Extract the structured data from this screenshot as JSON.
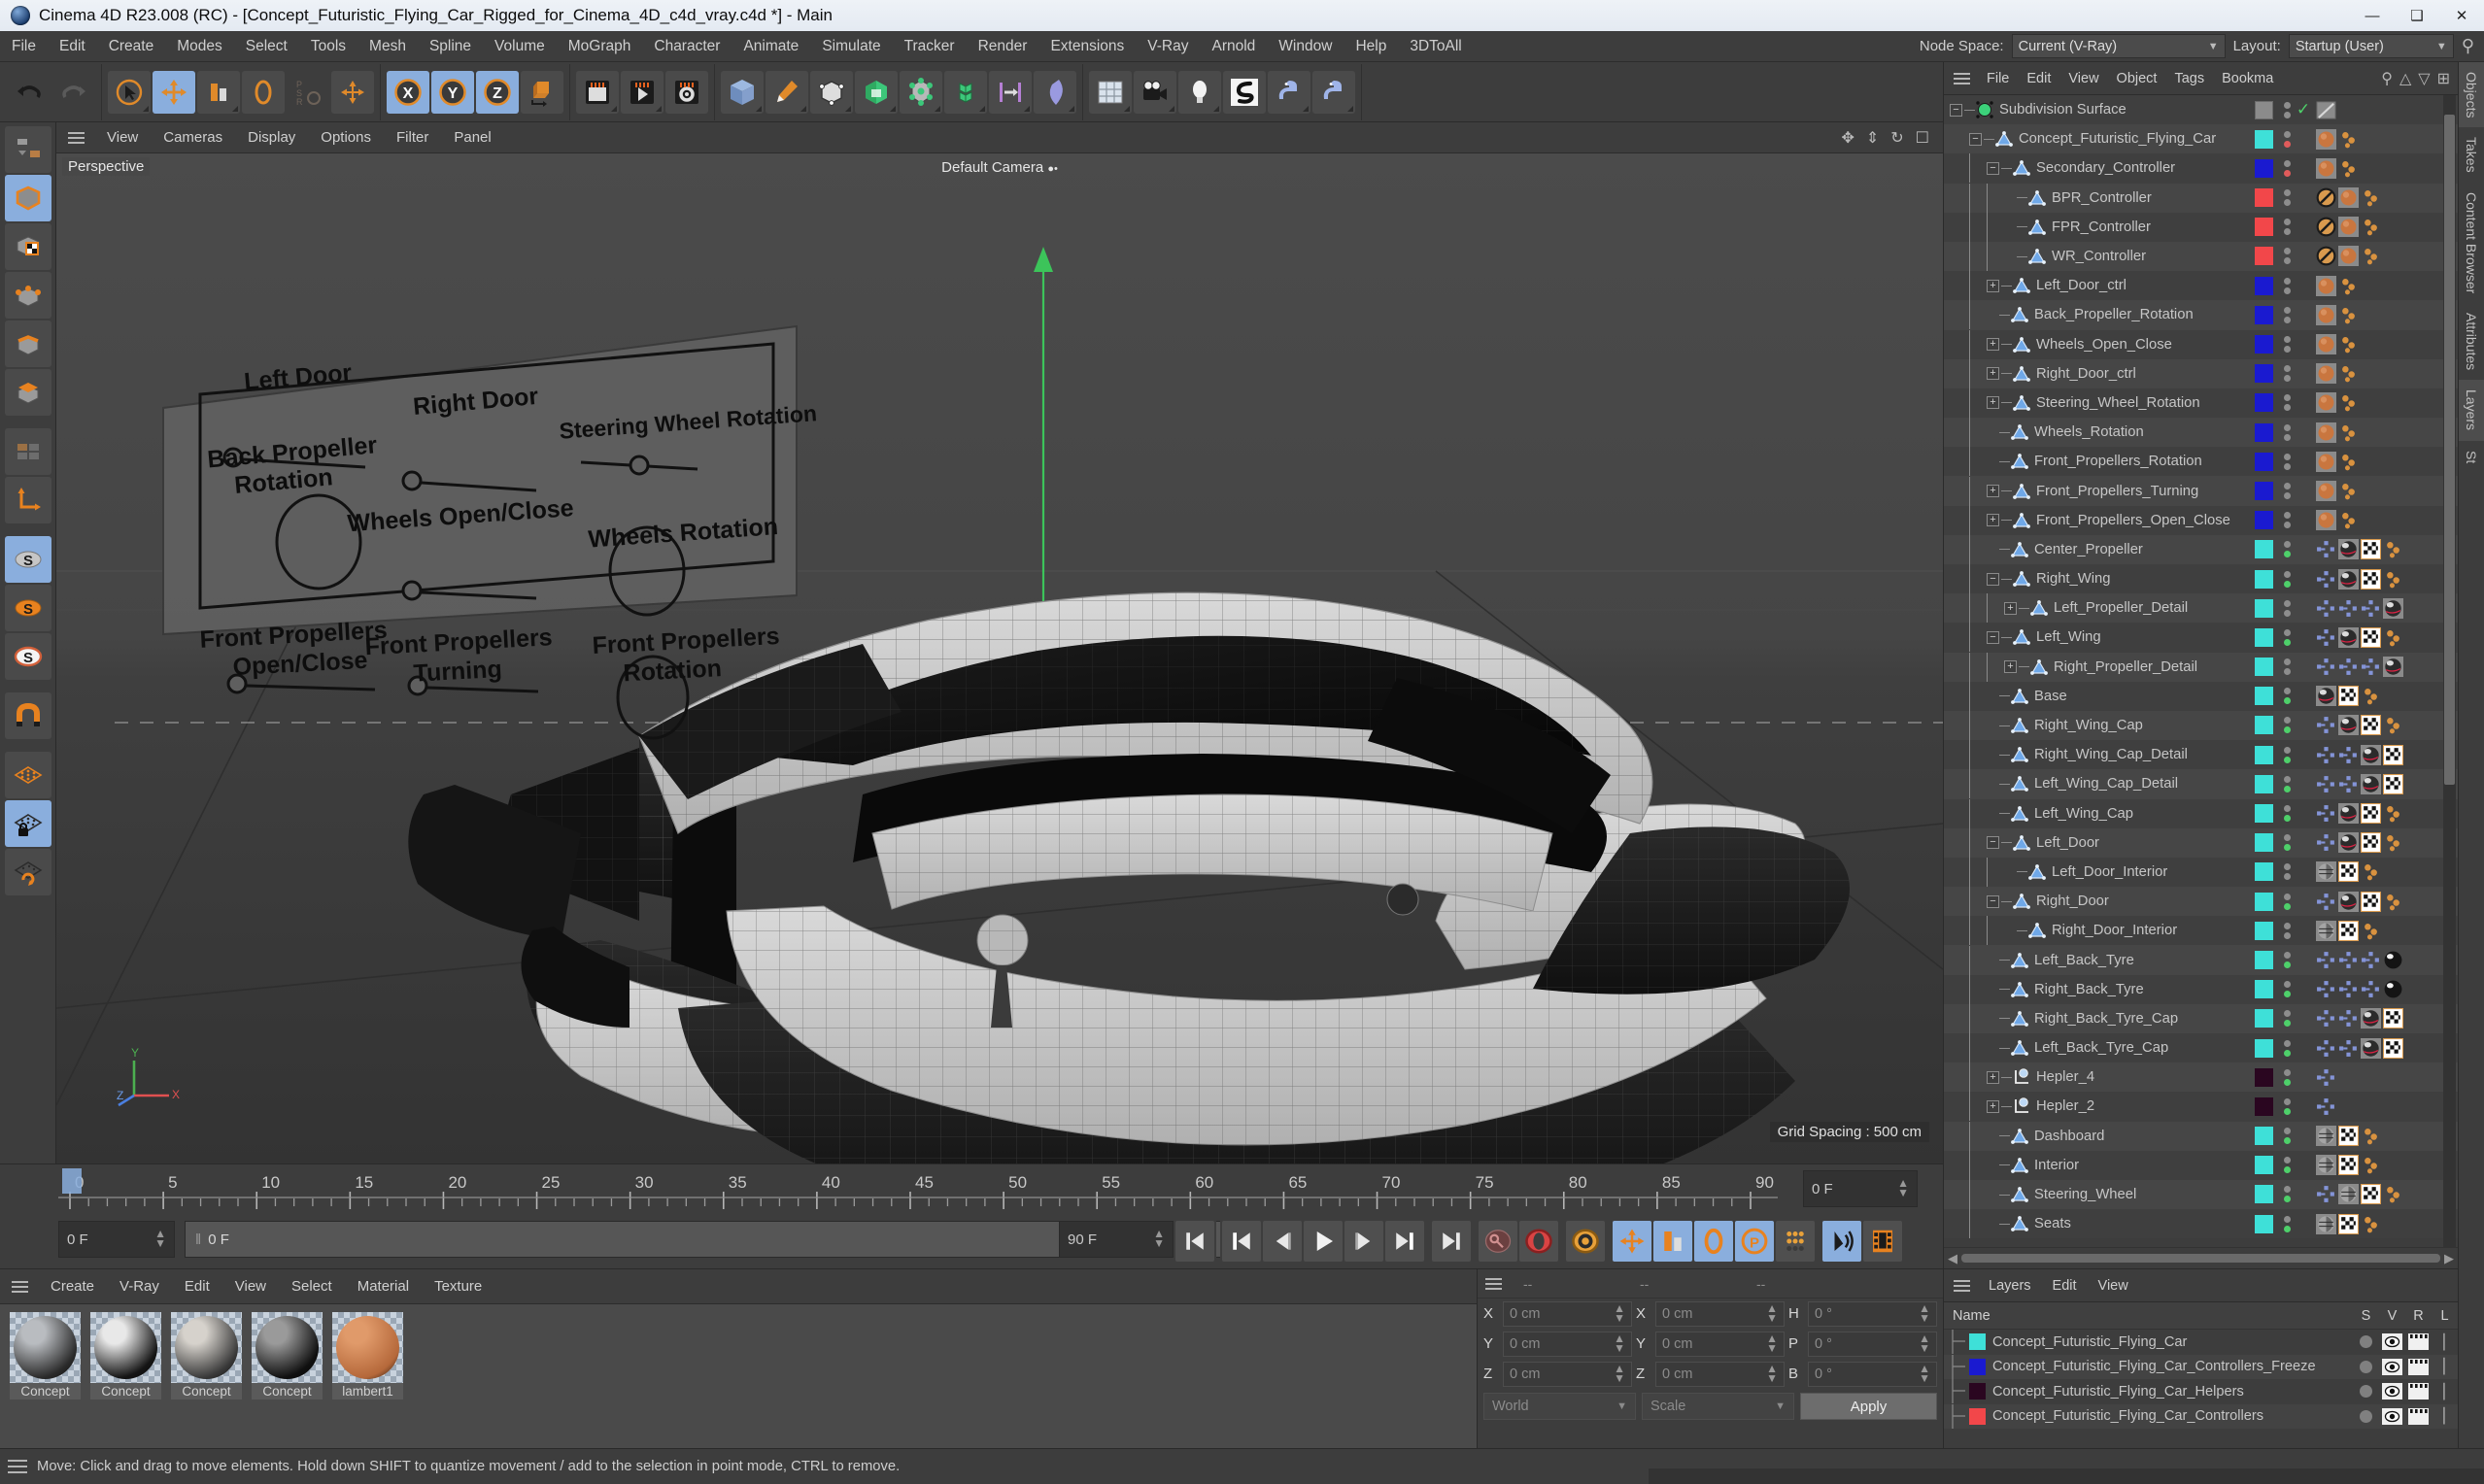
{
  "window": {
    "title": "Cinema 4D R23.008 (RC) - [Concept_Futuristic_Flying_Car_Rigged_for_Cinema_4D_c4d_vray.c4d *] - Main",
    "minimize": "—",
    "maximize": "❑",
    "close": "✕"
  },
  "menubar": {
    "items": [
      "File",
      "Edit",
      "Create",
      "Modes",
      "Select",
      "Tools",
      "Mesh",
      "Spline",
      "Volume",
      "MoGraph",
      "Character",
      "Animate",
      "Simulate",
      "Tracker",
      "Render",
      "Extensions",
      "V-Ray",
      "Arnold",
      "Window",
      "Help",
      "3DToAll"
    ],
    "node_space_label": "Node Space:",
    "node_space_value": "Current (V-Ray)",
    "layout_label": "Layout:",
    "layout_value": "Startup (User)"
  },
  "viewport": {
    "menu": [
      "View",
      "Cameras",
      "Display",
      "Options",
      "Filter",
      "Panel"
    ],
    "label": "Perspective",
    "camera": "Default Camera",
    "grid_spacing": "Grid Spacing : 500 cm",
    "axis": {
      "x": "X",
      "y": "Y",
      "z": "Z"
    },
    "hud_controls": [
      "Left Door",
      "Right Door",
      "Steering Wheel Rotation",
      "Back Propeller Rotation",
      "Wheels Open/Close",
      "Wheels Rotation",
      "Front Propellers Open/Close",
      "Front Propellers Turning",
      "Front Propellers Rotation"
    ]
  },
  "timeline": {
    "ticks": [
      0,
      5,
      10,
      15,
      20,
      25,
      30,
      35,
      40,
      45,
      50,
      55,
      60,
      65,
      70,
      75,
      80,
      85,
      90
    ],
    "current_frame": "0 F",
    "bar_frame": "0 F",
    "range_end": "90 F",
    "end_field": "90 F",
    "right_field": "0 F",
    "playhead_frame": 0
  },
  "materials": {
    "menu": [
      "Create",
      "V-Ray",
      "Edit",
      "View",
      "Select",
      "Material",
      "Texture"
    ],
    "items": [
      {
        "name": "Concept",
        "color1": "#b9bcc0",
        "color2": "#2b2b2b"
      },
      {
        "name": "Concept",
        "color1": "#e8e8e8",
        "color2": "#151515"
      },
      {
        "name": "Concept",
        "color1": "#d6d2cc",
        "color2": "#3a3a3a"
      },
      {
        "name": "Concept",
        "color1": "#9a9a9a",
        "color2": "#101010"
      },
      {
        "name": "lambert1",
        "color1": "#e09a6a",
        "color2": "#b5683a"
      }
    ]
  },
  "coordinates": {
    "header": [
      "--",
      "--",
      "--"
    ],
    "rows": [
      {
        "l1": "X",
        "v1": "0 cm",
        "l2": "X",
        "v2": "0 cm",
        "l3": "H",
        "v3": "0 °"
      },
      {
        "l1": "Y",
        "v1": "0 cm",
        "l2": "Y",
        "v2": "0 cm",
        "l3": "P",
        "v3": "0 °"
      },
      {
        "l1": "Z",
        "v1": "0 cm",
        "l2": "Z",
        "v2": "0 cm",
        "l3": "B",
        "v3": "0 °"
      }
    ],
    "world": "World",
    "scale": "Scale",
    "apply": "Apply"
  },
  "object_manager": {
    "menu": [
      "File",
      "Edit",
      "View",
      "Object",
      "Tags",
      "Bookma"
    ],
    "rows": [
      {
        "name": "Subdivision Surface",
        "depth": 0,
        "expander": "minus",
        "icon": "subdivision",
        "swatch": null,
        "dots": "check",
        "tags": [
          "disabled-slash"
        ]
      },
      {
        "name": "Concept_Futuristic_Flying_Car",
        "depth": 1,
        "expander": "minus",
        "icon": "null",
        "swatch": "#3ee0d8",
        "dots": "gray-red",
        "tags": [
          "ball-orange",
          "dots-orange"
        ]
      },
      {
        "name": "Secondary_Controller",
        "depth": 2,
        "expander": "minus",
        "icon": "null",
        "swatch": "#1a1ad0",
        "dots": "gray-red",
        "tags": [
          "ball-orange",
          "dots-orange"
        ]
      },
      {
        "name": "BPR_Controller",
        "depth": 3,
        "expander": "none",
        "icon": "null",
        "swatch": "#f2474a",
        "dots": "gray-gray",
        "tags": [
          "slash",
          "ball-orange",
          "dots-orange"
        ]
      },
      {
        "name": "FPR_Controller",
        "depth": 3,
        "expander": "none",
        "icon": "null",
        "swatch": "#f2474a",
        "dots": "gray-gray",
        "tags": [
          "slash",
          "ball-orange",
          "dots-orange"
        ]
      },
      {
        "name": "WR_Controller",
        "depth": 3,
        "expander": "none",
        "icon": "null",
        "swatch": "#f2474a",
        "dots": "gray-gray",
        "tags": [
          "slash",
          "ball-orange",
          "dots-orange"
        ]
      },
      {
        "name": "Left_Door_ctrl",
        "depth": 2,
        "expander": "plus",
        "icon": "null",
        "swatch": "#1a1ad0",
        "dots": "gray-gray",
        "tags": [
          "ball-orange",
          "dots-orange"
        ]
      },
      {
        "name": "Back_Propeller_Rotation",
        "depth": 2,
        "expander": "none",
        "icon": "null",
        "swatch": "#1a1ad0",
        "dots": "gray-gray",
        "tags": [
          "ball-orange",
          "dots-orange"
        ]
      },
      {
        "name": "Wheels_Open_Close",
        "depth": 2,
        "expander": "plus",
        "icon": "null",
        "swatch": "#1a1ad0",
        "dots": "gray-gray",
        "tags": [
          "ball-orange",
          "dots-orange"
        ]
      },
      {
        "name": "Right_Door_ctrl",
        "depth": 2,
        "expander": "plus",
        "icon": "null",
        "swatch": "#1a1ad0",
        "dots": "gray-gray",
        "tags": [
          "ball-orange",
          "dots-orange"
        ]
      },
      {
        "name": "Steering_Wheel_Rotation",
        "depth": 2,
        "expander": "plus",
        "icon": "null",
        "swatch": "#1a1ad0",
        "dots": "gray-gray",
        "tags": [
          "ball-orange",
          "dots-orange"
        ]
      },
      {
        "name": "Wheels_Rotation",
        "depth": 2,
        "expander": "none",
        "icon": "null",
        "swatch": "#1a1ad0",
        "dots": "gray-gray",
        "tags": [
          "ball-orange",
          "dots-orange"
        ]
      },
      {
        "name": "Front_Propellers_Rotation",
        "depth": 2,
        "expander": "none",
        "icon": "null",
        "swatch": "#1a1ad0",
        "dots": "gray-gray",
        "tags": [
          "ball-orange",
          "dots-orange"
        ]
      },
      {
        "name": "Front_Propellers_Turning",
        "depth": 2,
        "expander": "plus",
        "icon": "null",
        "swatch": "#1a1ad0",
        "dots": "gray-gray",
        "tags": [
          "ball-orange",
          "dots-orange"
        ]
      },
      {
        "name": "Front_Propellers_Open_Close",
        "depth": 2,
        "expander": "plus",
        "icon": "null",
        "swatch": "#1a1ad0",
        "dots": "gray-gray",
        "tags": [
          "ball-orange",
          "dots-orange"
        ]
      },
      {
        "name": "Center_Propeller",
        "depth": 2,
        "expander": "none",
        "icon": "null",
        "swatch": "#3ee0d8",
        "dots": "gray-green",
        "tags": [
          "nodes",
          "mat-chrome",
          "checker",
          "dots-orange"
        ]
      },
      {
        "name": "Right_Wing",
        "depth": 2,
        "expander": "minus",
        "icon": "null",
        "swatch": "#3ee0d8",
        "dots": "gray-green",
        "tags": [
          "nodes",
          "mat-chrome",
          "checker",
          "dots-orange"
        ]
      },
      {
        "name": "Left_Propeller_Detail",
        "depth": 3,
        "expander": "plus",
        "icon": "null",
        "swatch": "#3ee0d8",
        "dots": "gray-gray",
        "tags": [
          "nodes",
          "nodes",
          "nodes",
          "mat-chrome"
        ]
      },
      {
        "name": "Left_Wing",
        "depth": 2,
        "expander": "minus",
        "icon": "null",
        "swatch": "#3ee0d8",
        "dots": "gray-green",
        "tags": [
          "nodes",
          "mat-chrome",
          "checker",
          "dots-orange"
        ]
      },
      {
        "name": "Right_Propeller_Detail",
        "depth": 3,
        "expander": "plus",
        "icon": "null",
        "swatch": "#3ee0d8",
        "dots": "gray-gray",
        "tags": [
          "nodes",
          "nodes",
          "nodes",
          "mat-chrome"
        ]
      },
      {
        "name": "Base",
        "depth": 2,
        "expander": "none",
        "icon": "null",
        "swatch": "#3ee0d8",
        "dots": "gray-green",
        "tags": [
          "mat-chrome",
          "checker",
          "dots-orange"
        ]
      },
      {
        "name": "Right_Wing_Cap",
        "depth": 2,
        "expander": "none",
        "icon": "null",
        "swatch": "#3ee0d8",
        "dots": "gray-green",
        "tags": [
          "nodes",
          "mat-chrome",
          "checker",
          "dots-orange"
        ]
      },
      {
        "name": "Right_Wing_Cap_Detail",
        "depth": 2,
        "expander": "none",
        "icon": "null",
        "swatch": "#3ee0d8",
        "dots": "gray-green",
        "tags": [
          "nodes",
          "nodes",
          "mat-chrome",
          "checker"
        ]
      },
      {
        "name": "Left_Wing_Cap_Detail",
        "depth": 2,
        "expander": "none",
        "icon": "null",
        "swatch": "#3ee0d8",
        "dots": "gray-green",
        "tags": [
          "nodes",
          "nodes",
          "mat-chrome",
          "checker"
        ]
      },
      {
        "name": "Left_Wing_Cap",
        "depth": 2,
        "expander": "none",
        "icon": "null",
        "swatch": "#3ee0d8",
        "dots": "gray-green",
        "tags": [
          "nodes",
          "mat-chrome",
          "checker",
          "dots-orange"
        ]
      },
      {
        "name": "Left_Door",
        "depth": 2,
        "expander": "minus",
        "icon": "null",
        "swatch": "#3ee0d8",
        "dots": "gray-green",
        "tags": [
          "nodes",
          "mat-chrome",
          "checker",
          "dots-orange"
        ]
      },
      {
        "name": "Left_Door_Interior",
        "depth": 3,
        "expander": "none",
        "icon": "null",
        "swatch": "#3ee0d8",
        "dots": "gray-gray",
        "tags": [
          "mat-grey",
          "checker",
          "dots-orange"
        ]
      },
      {
        "name": "Right_Door",
        "depth": 2,
        "expander": "minus",
        "icon": "null",
        "swatch": "#3ee0d8",
        "dots": "gray-green",
        "tags": [
          "nodes",
          "mat-chrome",
          "checker",
          "dots-orange"
        ]
      },
      {
        "name": "Right_Door_Interior",
        "depth": 3,
        "expander": "none",
        "icon": "null",
        "swatch": "#3ee0d8",
        "dots": "gray-gray",
        "tags": [
          "mat-grey",
          "checker",
          "dots-orange"
        ]
      },
      {
        "name": "Left_Back_Tyre",
        "depth": 2,
        "expander": "none",
        "icon": "null",
        "swatch": "#3ee0d8",
        "dots": "gray-green",
        "tags": [
          "nodes",
          "nodes",
          "nodes",
          "mat-dark"
        ]
      },
      {
        "name": "Right_Back_Tyre",
        "depth": 2,
        "expander": "none",
        "icon": "null",
        "swatch": "#3ee0d8",
        "dots": "gray-green",
        "tags": [
          "nodes",
          "nodes",
          "nodes",
          "mat-dark"
        ]
      },
      {
        "name": "Right_Back_Tyre_Cap",
        "depth": 2,
        "expander": "none",
        "icon": "null",
        "swatch": "#3ee0d8",
        "dots": "gray-green",
        "tags": [
          "nodes",
          "nodes",
          "mat-chrome",
          "checker"
        ]
      },
      {
        "name": "Left_Back_Tyre_Cap",
        "depth": 2,
        "expander": "none",
        "icon": "null",
        "swatch": "#3ee0d8",
        "dots": "gray-green",
        "tags": [
          "nodes",
          "nodes",
          "mat-chrome",
          "checker"
        ]
      },
      {
        "name": "Hepler_4",
        "depth": 2,
        "expander": "plus",
        "icon": "helper",
        "swatch": "#2a0620",
        "dots": "gray-green",
        "tags": [
          "nodes"
        ]
      },
      {
        "name": "Hepler_2",
        "depth": 2,
        "expander": "plus",
        "icon": "helper",
        "swatch": "#2a0620",
        "dots": "gray-green",
        "tags": [
          "nodes"
        ]
      },
      {
        "name": "Dashboard",
        "depth": 2,
        "expander": "none",
        "icon": "null",
        "swatch": "#3ee0d8",
        "dots": "gray-green",
        "tags": [
          "mat-grey",
          "checker",
          "dots-orange"
        ]
      },
      {
        "name": "Interior",
        "depth": 2,
        "expander": "none",
        "icon": "null",
        "swatch": "#3ee0d8",
        "dots": "gray-green",
        "tags": [
          "mat-grey",
          "checker",
          "dots-orange"
        ]
      },
      {
        "name": "Steering_Wheel",
        "depth": 2,
        "expander": "none",
        "icon": "null",
        "swatch": "#3ee0d8",
        "dots": "gray-green",
        "tags": [
          "nodes",
          "mat-grey",
          "checker",
          "dots-orange"
        ]
      },
      {
        "name": "Seats",
        "depth": 2,
        "expander": "none",
        "icon": "null",
        "swatch": "#3ee0d8",
        "dots": "gray-green",
        "tags": [
          "mat-grey",
          "checker",
          "dots-orange"
        ]
      }
    ]
  },
  "layer_manager": {
    "menu": [
      "Layers",
      "Edit",
      "View"
    ],
    "columns": [
      "Name",
      "S",
      "V",
      "R",
      "L"
    ],
    "rows": [
      {
        "name": "Concept_Futuristic_Flying_Car",
        "color": "#3ee0d8"
      },
      {
        "name": "Concept_Futuristic_Flying_Car_Controllers_Freeze",
        "color": "#1a1ad0"
      },
      {
        "name": "Concept_Futuristic_Flying_Car_Helpers",
        "color": "#2a0620"
      },
      {
        "name": "Concept_Futuristic_Flying_Car_Controllers",
        "color": "#f2474a"
      }
    ]
  },
  "vertical_tabs": [
    "Objects",
    "Takes",
    "Content Browser",
    "Attributes",
    "Layers",
    "St"
  ],
  "statusbar": {
    "message": "Move: Click and drag to move elements. Hold down SHIFT to quantize movement / add to the selection in point mode, CTRL to remove."
  }
}
